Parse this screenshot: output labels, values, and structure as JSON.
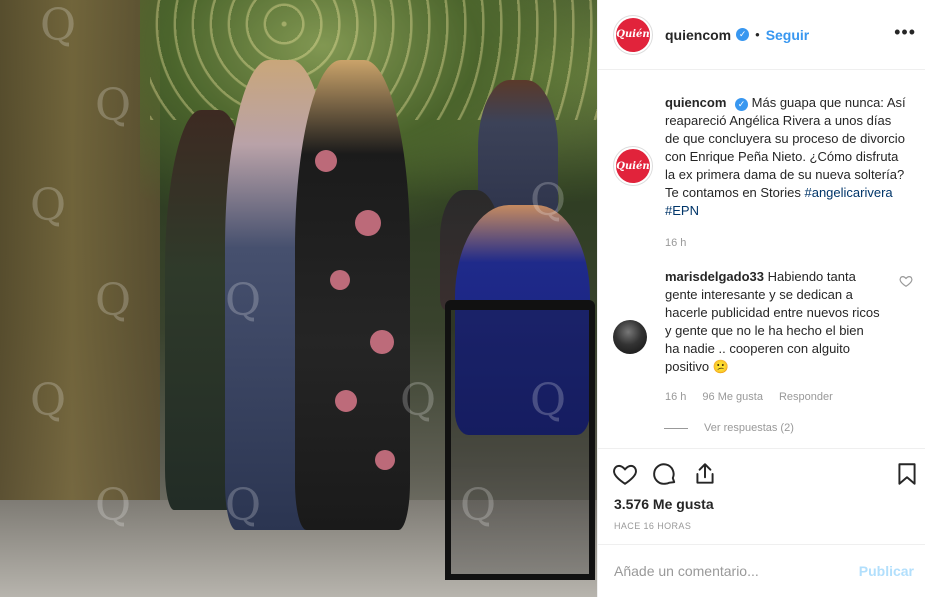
{
  "post": {
    "image_alt": "Foto de Angélica Rivera en un evento",
    "watermark": "Q"
  },
  "header": {
    "avatar_text": "Quién",
    "username": "quiencom",
    "separator": "•",
    "follow_label": "Seguir",
    "more_glyph": "•••"
  },
  "caption": {
    "avatar_text": "Quién",
    "username": "quiencom",
    "text": "Más guapa que nunca: Así reapareció Angélica Rivera a unos días de que concluyera su proceso de divorcio con Enrique Peña Nieto. ¿Cómo disfruta la ex primera dama de su nueva soltería? Te contamos en Stories",
    "hashtags": [
      "#angelicarivera",
      "#EPN"
    ],
    "time": "16 h"
  },
  "comment": {
    "username": "marisdelgado33",
    "text": "Habiendo tanta gente interesante y se dedican a hacerle publicidad entre nuevos ricos y gente que no le ha hecho el bien ha nadie .. cooperen con alguito positivo",
    "emoji": "😕",
    "time": "16 h",
    "likes": "96 Me gusta",
    "reply_label": "Responder",
    "view_replies": "Ver respuestas (2)"
  },
  "actions": {
    "likes_count": "3.576 Me gusta",
    "posted_ago": "HACE 16 HORAS",
    "icons": [
      "heart-icon",
      "comment-icon",
      "share-icon",
      "bookmark-icon"
    ]
  },
  "add_comment": {
    "placeholder": "Añade un comentario...",
    "publish_label": "Publicar"
  },
  "colors": {
    "accent": "#3897f0",
    "brand": "#e1233b",
    "hashtag": "#003569",
    "muted": "#999999",
    "publish_disabled": "#b2dffc"
  }
}
